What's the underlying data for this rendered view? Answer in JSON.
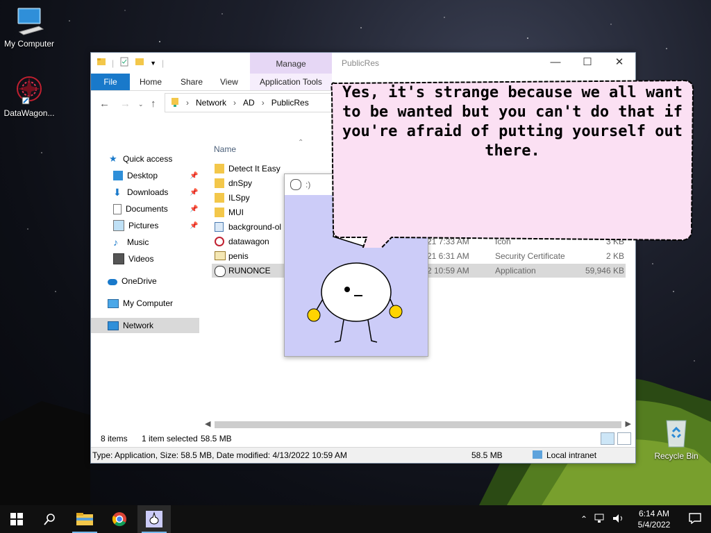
{
  "desktop": {
    "icons": [
      {
        "label": "My Computer"
      },
      {
        "label": "DataWagon..."
      },
      {
        "label": "Recycle Bin"
      }
    ]
  },
  "explorer": {
    "title": "PublicRes",
    "manage_label": "Manage",
    "tabs": [
      "File",
      "Home",
      "Share",
      "View",
      "Application Tools"
    ],
    "breadcrumb": [
      "Network",
      "AD",
      "PublicRes"
    ],
    "nav": [
      {
        "label": "Quick access"
      },
      {
        "label": "Desktop"
      },
      {
        "label": "Downloads"
      },
      {
        "label": "Documents"
      },
      {
        "label": "Pictures"
      },
      {
        "label": "Music"
      },
      {
        "label": "Videos"
      },
      {
        "label": "OneDrive"
      },
      {
        "label": "My Computer"
      },
      {
        "label": "Network"
      }
    ],
    "column_name": "Name",
    "files": [
      {
        "name": "Detect It Easy",
        "date": "",
        "type": "",
        "size": ""
      },
      {
        "name": "dnSpy",
        "date": "",
        "type": "",
        "size": ""
      },
      {
        "name": "ILSpy",
        "date": "",
        "type": "",
        "size": ""
      },
      {
        "name": "MUI",
        "date": "",
        "type": "",
        "size": ""
      },
      {
        "name": "background-ol",
        "date": "",
        "type": "",
        "size": ""
      },
      {
        "name": "datawagon",
        "date": "21 7:33 AM",
        "type": "Icon",
        "size": "3 KB"
      },
      {
        "name": "penis",
        "date": "21 6:31 AM",
        "type": "Security Certificate",
        "size": "2 KB"
      },
      {
        "name": "RUNONCE",
        "date": "2 10:59 AM",
        "type": "Application",
        "size": "59,946 KB"
      }
    ],
    "status": {
      "items": "8 items",
      "selected": "1 item selected",
      "selected_size": "58.5 MB"
    },
    "details": {
      "info": "Type: Application, Size: 58.5 MB, Date modified: 4/13/2022 10:59 AM",
      "size": "58.5 MB",
      "zone": "Local intranet"
    }
  },
  "popup": {
    "title": ":)"
  },
  "bubble": {
    "text": "Yes, it's strange because we all want to be wanted but you can't do that if you're afraid of putting yourself out there."
  },
  "taskbar": {
    "time": "6:14 AM",
    "date": "5/4/2022"
  }
}
